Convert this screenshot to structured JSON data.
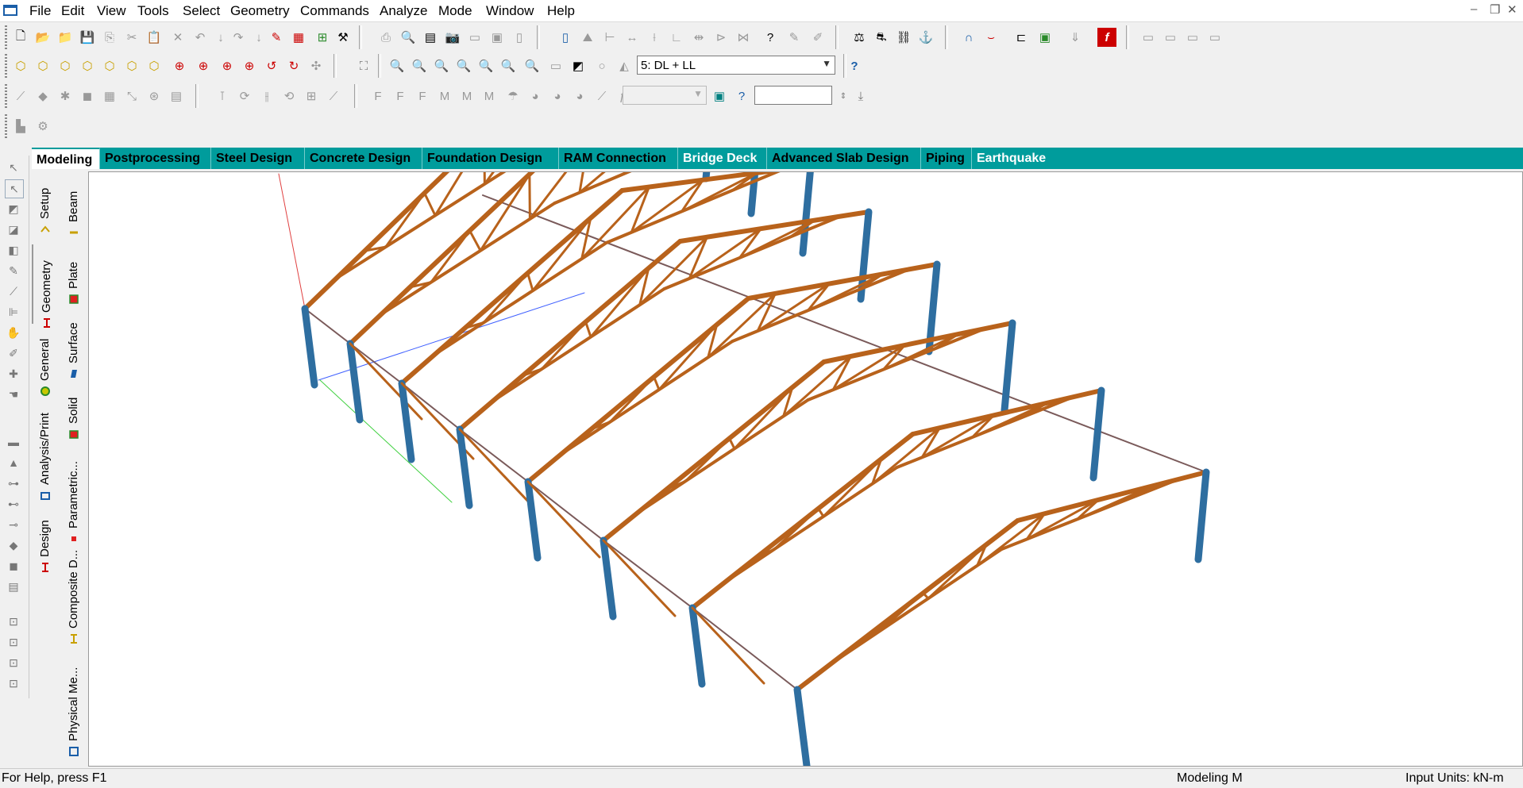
{
  "menu": [
    "File",
    "Edit",
    "View",
    "Tools",
    "Select",
    "Geometry",
    "Commands",
    "Analyze",
    "Mode",
    "Window",
    "Help"
  ],
  "window_controls": [
    "–",
    "❐",
    "✕"
  ],
  "load_case": {
    "value": "5: DL + LL"
  },
  "tabs": [
    "Modeling",
    "Postprocessing",
    "Steel Design",
    "Concrete Design",
    "Foundation Design",
    "RAM Connection",
    "Bridge Deck",
    "Advanced Slab Design",
    "Piping",
    "Earthquake"
  ],
  "vertical_tabs_primary": [
    "Setup",
    "Geometry",
    "General",
    "Analysis/Print",
    "Design"
  ],
  "vertical_tabs_secondary": [
    "Beam",
    "Plate",
    "Surface",
    "Solid",
    "Parametric...",
    "Composite D...",
    "Physical Me..."
  ],
  "status": {
    "help": "For Help, press F1",
    "mode": "Modeling M",
    "units": "Input Units:  kN-m"
  },
  "colors": {
    "tab_bar": "#009c9c",
    "truss": "#b8621b",
    "column": "#2e6ea0",
    "edge": "#7a5a5a"
  }
}
